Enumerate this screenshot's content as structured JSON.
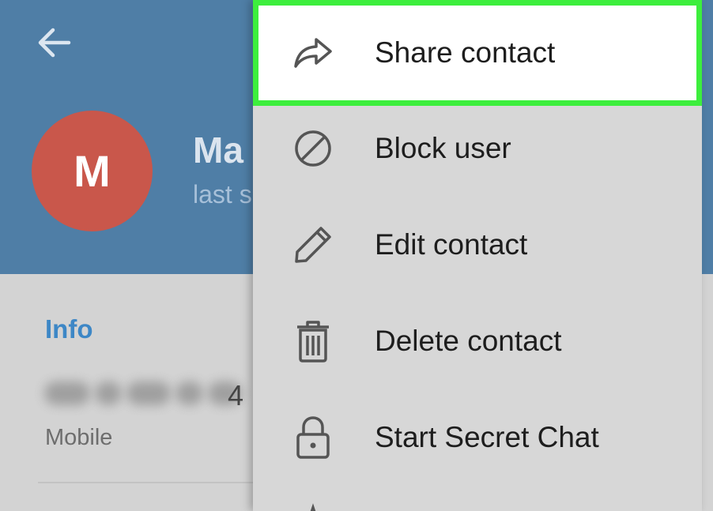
{
  "header": {
    "name": "Ma",
    "status": "last s",
    "avatar_initial": "M",
    "back_icon": "arrow-left-icon"
  },
  "info": {
    "section_title": "Info",
    "phone_visible_digits": "4",
    "phone_label": "Mobile"
  },
  "menu": {
    "items": [
      {
        "label": "Share contact",
        "icon": "share-icon",
        "highlighted": true
      },
      {
        "label": "Block user",
        "icon": "block-icon"
      },
      {
        "label": "Edit contact",
        "icon": "pencil-icon"
      },
      {
        "label": "Delete contact",
        "icon": "trash-icon"
      },
      {
        "label": "Start Secret Chat",
        "icon": "lock-icon"
      }
    ]
  },
  "colors": {
    "header_bg": "#4f7ea6",
    "avatar_bg": "#c9574b",
    "accent_blue": "#3d87c6",
    "highlight_border": "#3dee3d",
    "menu_bg": "#d7d7d7"
  }
}
